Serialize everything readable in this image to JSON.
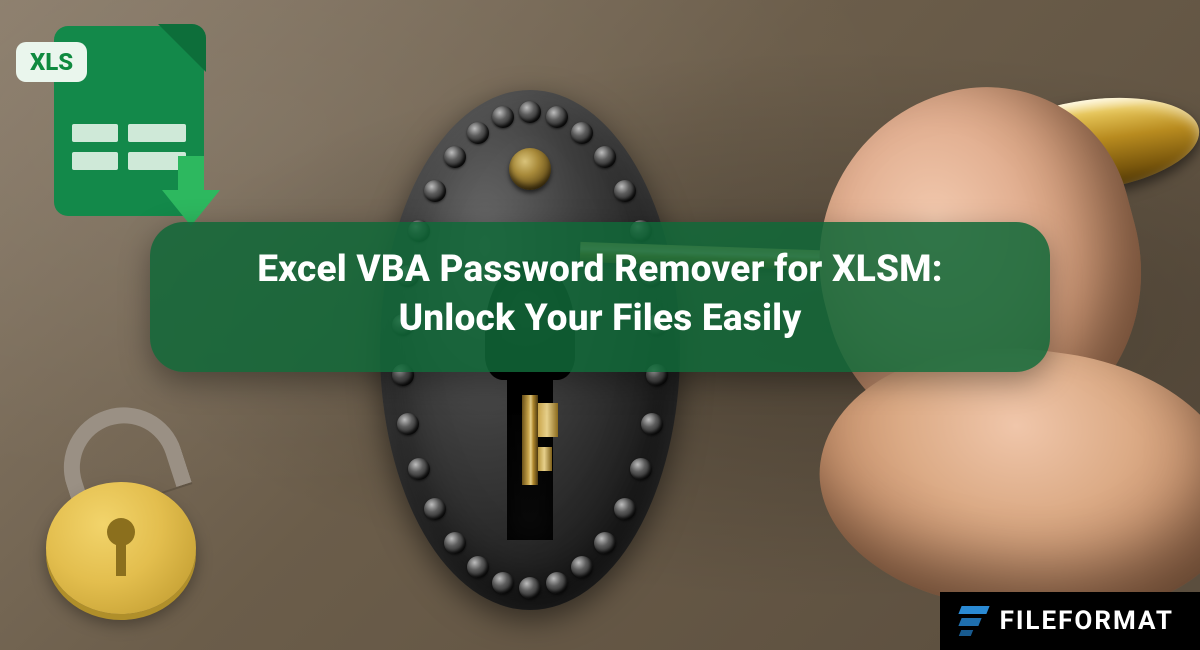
{
  "title": {
    "line1": "Excel VBA Password Remover for XLSM:",
    "line2": "Unlock Your Files Easily"
  },
  "xls_badge_label": "XLS",
  "brand_text": "FILEFORMAT",
  "colors": {
    "accent_green": "#13894a",
    "pill_green": "rgba(16,104,56,0.86)",
    "brand_blue": "#2a8ad4",
    "lock_gold": "#e3be4e"
  }
}
